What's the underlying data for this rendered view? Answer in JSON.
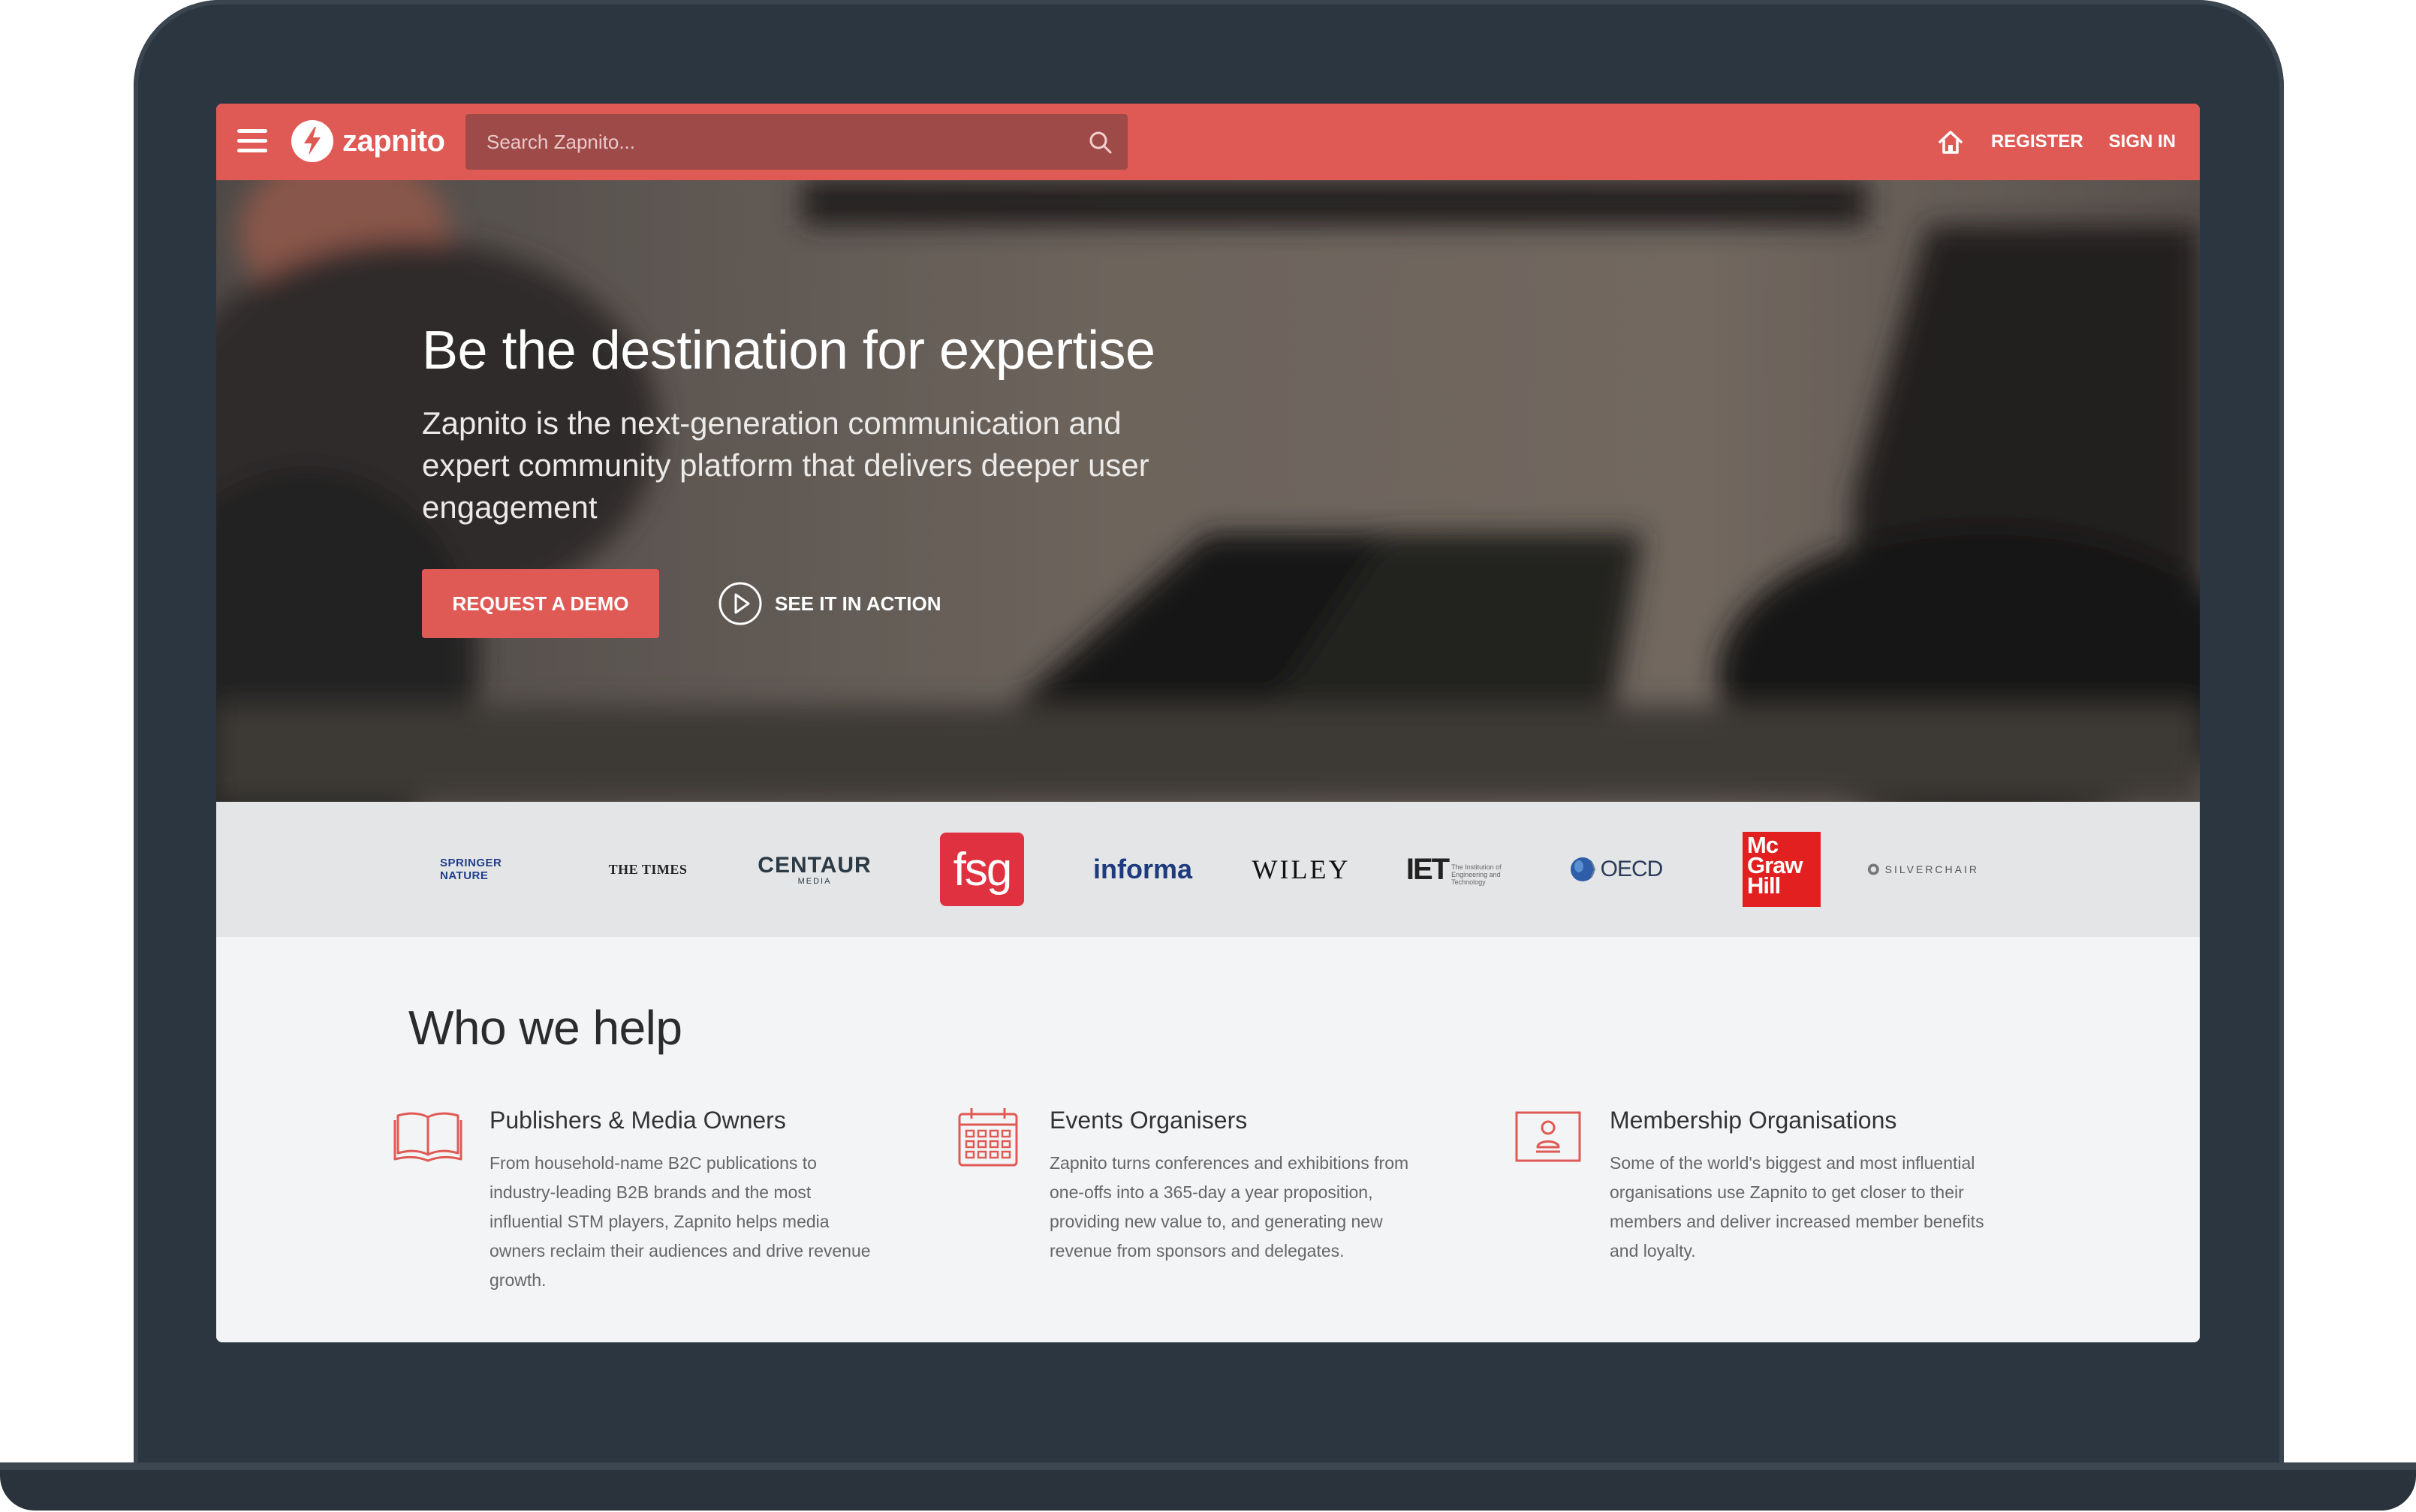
{
  "nav": {
    "brand": "zapnito",
    "search_placeholder": "Search Zapnito...",
    "register": "REGISTER",
    "sign_in": "SIGN IN"
  },
  "hero": {
    "title": "Be the destination for expertise",
    "subtitle": "Zapnito is the next-generation communication and expert community platform that delivers deeper user engagement",
    "cta_primary": "REQUEST A DEMO",
    "cta_secondary": "SEE IT IN ACTION"
  },
  "logos": {
    "springer": "SPRINGER NATURE",
    "times": "THE TIMES",
    "centaur": "CENTAUR",
    "centaur_sub": "MEDIA",
    "fsg": "fsg",
    "informa": "informa",
    "wiley": "WILEY",
    "iet": "IET",
    "iet_sub": "The Institution of Engineering and Technology",
    "oecd": "OECD",
    "mcgraw": [
      "Mc",
      "Graw",
      "Hill"
    ],
    "silverchair": "SILVERCHAIR"
  },
  "who": {
    "title": "Who we help",
    "cards": [
      {
        "title": "Publishers & Media Owners",
        "desc": "From household-name B2C publications to industry-leading B2B brands and the most influential STM players, Zapnito helps media owners reclaim their audiences and drive revenue growth.",
        "icon": "book-icon"
      },
      {
        "title": "Events Organisers",
        "desc": "Zapnito turns conferences and exhibitions from one-offs into a 365-day a year proposition, providing new value to, and generating new revenue from sponsors and delegates.",
        "icon": "calendar-icon"
      },
      {
        "title": "Membership Organisations",
        "desc": "Some of the world's biggest and most influential organisations use Zapnito to get closer to their members and deliver increased member benefits and loyalty.",
        "icon": "member-card-icon"
      }
    ]
  },
  "colors": {
    "accent": "#e05a55",
    "laptop_frame": "#2c3640"
  }
}
